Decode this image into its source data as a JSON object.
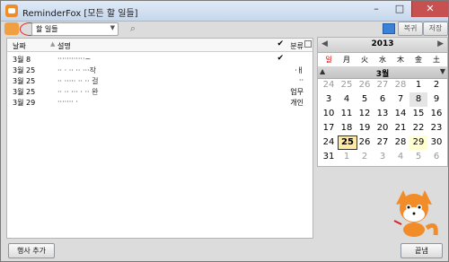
{
  "window": {
    "title": "ReminderFox [모든 할 일들]"
  },
  "toolbar": {
    "filter_value": "할 일들",
    "restore_label": "복귀",
    "save_label": "저장"
  },
  "list": {
    "headers": {
      "date": "날짜",
      "desc": "설명",
      "category": "분류"
    },
    "rows": [
      {
        "date": "3월 8",
        "desc": "············~",
        "check": "✔",
        "category": ""
      },
      {
        "date": "3월 25",
        "desc": "·· · ·· ·· ···작",
        "check": "",
        "category": "·ㅐ"
      },
      {
        "date": "3월 25",
        "desc": "·· ····· ·· ·· 걸",
        "check": "",
        "category": "··"
      },
      {
        "date": "3월 25",
        "desc": "·· ·· ··· · ·· 완",
        "check": "",
        "category": "업무"
      },
      {
        "date": "3월 29",
        "desc": "······· ·",
        "check": "",
        "category": "개인"
      }
    ]
  },
  "calendar": {
    "year": "2013",
    "month": "3월",
    "weekdays": [
      "일",
      "月",
      "火",
      "水",
      "木",
      "金",
      "土"
    ],
    "weeks": [
      [
        "24",
        "25",
        "26",
        "27",
        "28",
        "1",
        "2"
      ],
      [
        "3",
        "4",
        "5",
        "6",
        "7",
        "8",
        "9"
      ],
      [
        "10",
        "11",
        "12",
        "13",
        "14",
        "15",
        "16"
      ],
      [
        "17",
        "18",
        "19",
        "20",
        "21",
        "22",
        "23"
      ],
      [
        "24",
        "25",
        "26",
        "27",
        "28",
        "29",
        "30"
      ],
      [
        "31",
        "1",
        "2",
        "3",
        "4",
        "5",
        "6"
      ]
    ]
  },
  "buttons": {
    "add_event": "행사 추가",
    "close": "끝냄"
  }
}
